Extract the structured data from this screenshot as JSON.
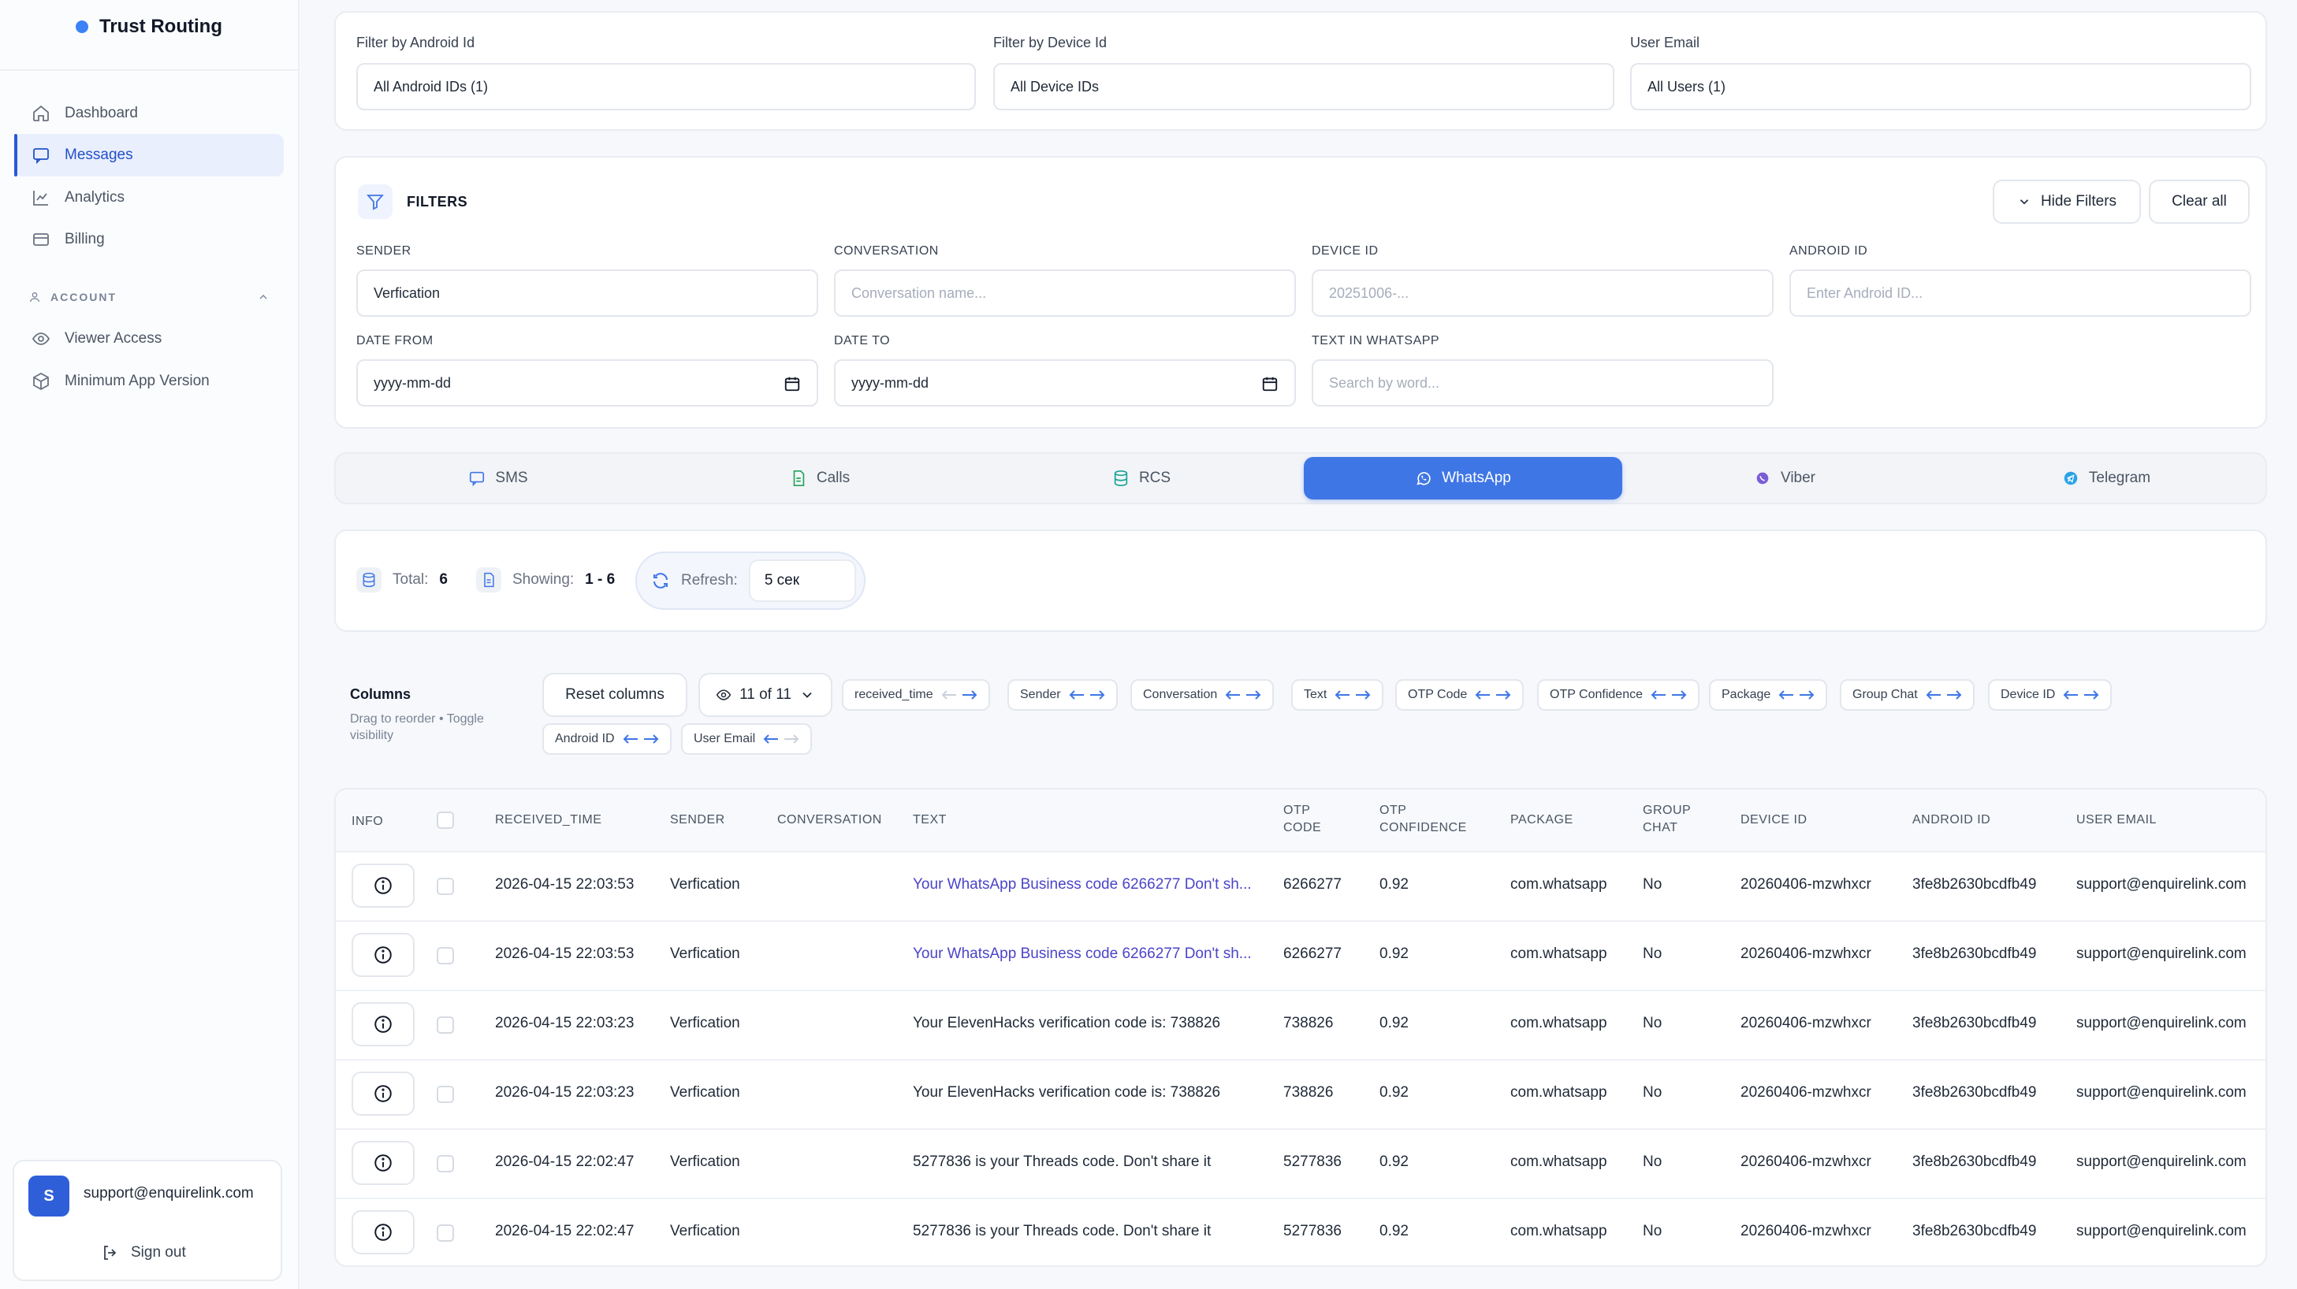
{
  "app": {
    "title": "Trust Routing"
  },
  "sidebar": {
    "items": [
      {
        "label": "Dashboard",
        "icon": "home-icon"
      },
      {
        "label": "Messages",
        "icon": "chat-bubble-icon",
        "active": true
      },
      {
        "label": "Analytics",
        "icon": "line-chart-icon"
      },
      {
        "label": "Billing",
        "icon": "credit-card-icon"
      }
    ],
    "account_heading": "ACCOUNT",
    "account_items": [
      {
        "label": "Viewer Access",
        "icon": "eye-icon"
      },
      {
        "label": "Minimum App Version",
        "icon": "package-icon"
      }
    ],
    "user": {
      "initial": "S",
      "email": "support@enquirelink.com",
      "signout_label": "Sign out"
    }
  },
  "top_filters": {
    "android": {
      "label": "Filter by Android Id",
      "value": "All Android IDs (1)"
    },
    "device": {
      "label": "Filter by Device Id",
      "value": "All Device IDs"
    },
    "email": {
      "label": "User Email",
      "value": "All Users (1)"
    }
  },
  "filters": {
    "title": "FILTERS",
    "hide_label": "Hide Filters",
    "clear_label": "Clear all",
    "sender": {
      "label": "SENDER",
      "value": "Verfication"
    },
    "conversation": {
      "label": "CONVERSATION",
      "placeholder": "Conversation name..."
    },
    "device_id": {
      "label": "DEVICE ID",
      "placeholder": "20251006-..."
    },
    "android_id": {
      "label": "ANDROID ID",
      "placeholder": "Enter Android ID..."
    },
    "date_from": {
      "label": "DATE FROM",
      "value": "yyyy-mm-dd"
    },
    "date_to": {
      "label": "DATE TO",
      "value": "yyyy-mm-dd"
    },
    "text_whatsapp": {
      "label": "TEXT IN WHATSAPP",
      "placeholder": "Search by word..."
    }
  },
  "tabs": [
    {
      "label": "SMS",
      "icon": "message-square-icon"
    },
    {
      "label": "Calls",
      "icon": "file-phone-icon"
    },
    {
      "label": "RCS",
      "icon": "database-icon"
    },
    {
      "label": "WhatsApp",
      "icon": "whatsapp-icon",
      "active": true
    },
    {
      "label": "Viber",
      "icon": "viber-icon"
    },
    {
      "label": "Telegram",
      "icon": "telegram-icon"
    }
  ],
  "stats": {
    "total_label": "Total:",
    "total_value": "6",
    "showing_label": "Showing:",
    "showing_value": "1 - 6",
    "refresh_label": "Refresh:",
    "refresh_value": "5 сек"
  },
  "columns_panel": {
    "title": "Columns",
    "hint": "Drag to reorder • Toggle visibility",
    "reset_label": "Reset columns",
    "visible_count": "11 of 11",
    "chips": [
      "received_time",
      "Sender",
      "Conversation",
      "Text",
      "OTP Code",
      "OTP Confidence",
      "Package",
      "Group Chat",
      "Device ID",
      "Android ID",
      "User Email"
    ]
  },
  "table": {
    "headers": {
      "info": "INFO",
      "received_time": "RECEIVED_TIME",
      "sender": "SENDER",
      "conversation": "CONVERSATION",
      "text": "TEXT",
      "otp_code_1": "OTP",
      "otp_code_2": "CODE",
      "otp_conf_1": "OTP",
      "otp_conf_2": "CONFIDENCE",
      "package": "PACKAGE",
      "group_1": "GROUP",
      "group_2": "CHAT",
      "device_id": "DEVICE ID",
      "android_id": "ANDROID ID",
      "user_email": "USER EMAIL"
    },
    "rows": [
      {
        "received_time": "2026-04-15 22:03:53",
        "sender": "Verfication",
        "conversation": "",
        "text": "Your WhatsApp Business code 6266277 Don't sh...",
        "otp_code": "6266277",
        "otp_confidence": "0.92",
        "package": "com.whatsapp",
        "group_chat": "No",
        "device_id": "20260406-mzwhxcr",
        "android_id": "3fe8b2630bcdfb49",
        "user_email": "support@enquirelink.com",
        "link": true
      },
      {
        "received_time": "2026-04-15 22:03:53",
        "sender": "Verfication",
        "conversation": "",
        "text": "Your WhatsApp Business code 6266277 Don't sh...",
        "otp_code": "6266277",
        "otp_confidence": "0.92",
        "package": "com.whatsapp",
        "group_chat": "No",
        "device_id": "20260406-mzwhxcr",
        "android_id": "3fe8b2630bcdfb49",
        "user_email": "support@enquirelink.com",
        "link": true
      },
      {
        "received_time": "2026-04-15 22:03:23",
        "sender": "Verfication",
        "conversation": "",
        "text": "Your ElevenHacks verification code is: 738826",
        "otp_code": "738826",
        "otp_confidence": "0.92",
        "package": "com.whatsapp",
        "group_chat": "No",
        "device_id": "20260406-mzwhxcr",
        "android_id": "3fe8b2630bcdfb49",
        "user_email": "support@enquirelink.com",
        "link": false
      },
      {
        "received_time": "2026-04-15 22:03:23",
        "sender": "Verfication",
        "conversation": "",
        "text": "Your ElevenHacks verification code is: 738826",
        "otp_code": "738826",
        "otp_confidence": "0.92",
        "package": "com.whatsapp",
        "group_chat": "No",
        "device_id": "20260406-mzwhxcr",
        "android_id": "3fe8b2630bcdfb49",
        "user_email": "support@enquirelink.com",
        "link": false
      },
      {
        "received_time": "2026-04-15 22:02:47",
        "sender": "Verfication",
        "conversation": "",
        "text": "5277836 is your Threads code. Don't share it",
        "otp_code": "5277836",
        "otp_confidence": "0.92",
        "package": "com.whatsapp",
        "group_chat": "No",
        "device_id": "20260406-mzwhxcr",
        "android_id": "3fe8b2630bcdfb49",
        "user_email": "support@enquirelink.com",
        "link": false
      },
      {
        "received_time": "2026-04-15 22:02:47",
        "sender": "Verfication",
        "conversation": "",
        "text": "5277836 is your Threads code. Don't share it",
        "otp_code": "5277836",
        "otp_confidence": "0.92",
        "package": "com.whatsapp",
        "group_chat": "No",
        "device_id": "20260406-mzwhxcr",
        "android_id": "3fe8b2630bcdfb49",
        "user_email": "support@enquirelink.com",
        "link": false
      }
    ]
  },
  "colors": {
    "accent": "#3f76e6",
    "link": "#4a44c9",
    "brand_dot": "#3b82f6",
    "active_nav_bg": "#e9effc"
  }
}
